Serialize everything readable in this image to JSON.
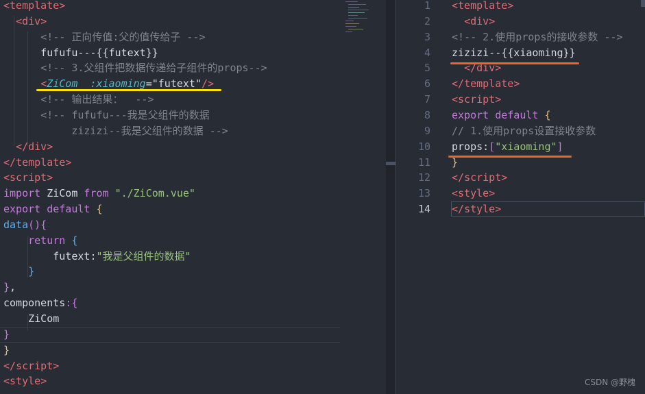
{
  "left_editor": {
    "lines": [
      [
        [
          "<",
          "tag"
        ],
        [
          "template",
          "tag"
        ],
        [
          ">",
          "tag"
        ]
      ],
      [
        [
          "  ",
          "plain"
        ],
        [
          "<",
          "tag"
        ],
        [
          "div",
          "tag"
        ],
        [
          ">",
          "tag"
        ]
      ],
      [
        [
          "      ",
          "plain"
        ],
        [
          "<!-- 正向传值:父的值传给子 -->",
          "comment"
        ]
      ],
      [
        [
          "      fufufu---{{futext}}",
          "plain"
        ]
      ],
      [
        [
          "      ",
          "plain"
        ],
        [
          "<!-- 3.父组件把数据传递给子组件的props-->",
          "comment"
        ]
      ],
      [
        [
          "      ",
          "plain"
        ],
        [
          "<",
          "tag"
        ],
        [
          "ZiCom",
          "comp"
        ],
        [
          "  ",
          "plain"
        ],
        [
          ":xiaoming",
          "attr"
        ],
        [
          "=",
          "plain"
        ],
        [
          "\"futext\"",
          "plain"
        ],
        [
          "/>",
          "tag"
        ]
      ],
      [
        [
          "      ",
          "plain"
        ],
        [
          "<!-- 输出结果：  -->",
          "comment"
        ]
      ],
      [
        [
          "      ",
          "plain"
        ],
        [
          "<!-- fufufu---我是父组件的数据",
          "comment"
        ]
      ],
      [
        [
          "           zizizi--我是父组件的数据 -->",
          "comment"
        ]
      ],
      [
        [
          "  ",
          "plain"
        ],
        [
          "</",
          "tag"
        ],
        [
          "div",
          "tag"
        ],
        [
          ">",
          "tag"
        ]
      ],
      [
        [
          "</",
          "tag"
        ],
        [
          "template",
          "tag"
        ],
        [
          ">",
          "tag"
        ]
      ],
      [
        [
          "<",
          "tag"
        ],
        [
          "script",
          "tag"
        ],
        [
          ">",
          "tag"
        ]
      ],
      [
        [
          "import ",
          "kw"
        ],
        [
          "ZiCom ",
          "plain"
        ],
        [
          "from ",
          "kw"
        ],
        [
          "\"./ZiCom.vue\"",
          "str"
        ]
      ],
      [
        [
          "export ",
          "kw"
        ],
        [
          "default ",
          "kw"
        ],
        [
          "{",
          "yellowbr"
        ]
      ],
      [
        [
          "data",
          "fn"
        ],
        [
          "(){",
          "pinkbr"
        ]
      ],
      [
        [
          "    ",
          "plain"
        ],
        [
          "return ",
          "kw"
        ],
        [
          "{",
          "bluebr"
        ]
      ],
      [
        [
          "        futext",
          "plain"
        ],
        [
          ":",
          "plain"
        ],
        [
          "\"我是父组件的数据\"",
          "str"
        ]
      ],
      [
        [
          "    ",
          "plain"
        ],
        [
          "}",
          "bluebr"
        ]
      ],
      [
        [
          "}",
          "pinkbr"
        ],
        [
          ",",
          "plain"
        ]
      ],
      [
        [
          "components",
          "plain"
        ],
        [
          ":{",
          "pinkbr"
        ]
      ],
      [
        [
          "    ZiCom",
          "plain"
        ]
      ],
      [
        [
          "}",
          "pinkbr"
        ]
      ],
      [
        [
          "}",
          "yellowbr"
        ]
      ],
      [
        [
          "</",
          "tag"
        ],
        [
          "script",
          "tag"
        ],
        [
          ">",
          "tag"
        ]
      ],
      [
        [
          "<",
          "tag"
        ],
        [
          "style",
          "tag"
        ],
        [
          ">",
          "tag"
        ]
      ]
    ]
  },
  "right_editor": {
    "line_numbers": [
      "1",
      "2",
      "3",
      "4",
      "5",
      "6",
      "7",
      "8",
      "9",
      "10",
      "11",
      "12",
      "13",
      "14"
    ],
    "lines": [
      [
        [
          "<",
          "tag"
        ],
        [
          "template",
          "tag"
        ],
        [
          ">",
          "tag"
        ]
      ],
      [
        [
          "  ",
          "plain"
        ],
        [
          "<",
          "tag"
        ],
        [
          "div",
          "tag"
        ],
        [
          ">",
          "tag"
        ]
      ],
      [
        [
          "<!-- 2.使用props的接收参数 -->",
          "comment"
        ]
      ],
      [
        [
          "zizizi--{{xiaoming}}",
          "plain"
        ]
      ],
      [
        [
          "  ",
          "plain"
        ],
        [
          "</",
          "tag"
        ],
        [
          "div",
          "tag"
        ],
        [
          ">",
          "tag"
        ]
      ],
      [
        [
          "</",
          "tag"
        ],
        [
          "template",
          "tag"
        ],
        [
          ">",
          "tag"
        ]
      ],
      [
        [
          "<",
          "tag"
        ],
        [
          "script",
          "tag"
        ],
        [
          ">",
          "tag"
        ]
      ],
      [
        [
          "export ",
          "kw"
        ],
        [
          "default ",
          "kw"
        ],
        [
          "{",
          "yellowbr"
        ]
      ],
      [
        [
          "// 1.使用props设置接收参数",
          "comment"
        ]
      ],
      [
        [
          "props",
          "plain"
        ],
        [
          ":",
          "plain"
        ],
        [
          "[",
          "pinkbr"
        ],
        [
          "\"xiaoming\"",
          "str"
        ],
        [
          "]",
          "pinkbr"
        ]
      ],
      [
        [
          "}",
          "yellowbr"
        ]
      ],
      [
        [
          "</",
          "tag"
        ],
        [
          "script",
          "tag"
        ],
        [
          ">",
          "tag"
        ]
      ],
      [
        [
          "<",
          "tag"
        ],
        [
          "style",
          "tag"
        ],
        [
          ">",
          "tag"
        ]
      ],
      [
        [
          "</",
          "tag"
        ],
        [
          "style",
          "tag"
        ],
        [
          ">",
          "tag"
        ]
      ]
    ]
  },
  "watermark": "CSDN @野槐",
  "colors": {
    "background": "#282c34",
    "highlight_yellow": "#ffe200",
    "highlight_orange": "#f26522"
  }
}
